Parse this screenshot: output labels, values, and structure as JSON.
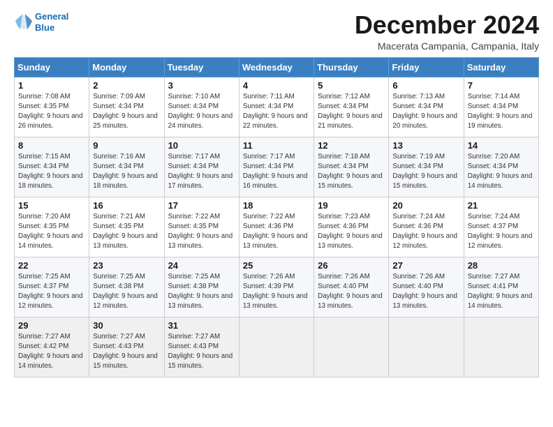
{
  "logo": {
    "line1": "General",
    "line2": "Blue"
  },
  "title": "December 2024",
  "location": "Macerata Campania, Campania, Italy",
  "days_of_week": [
    "Sunday",
    "Monday",
    "Tuesday",
    "Wednesday",
    "Thursday",
    "Friday",
    "Saturday"
  ],
  "weeks": [
    [
      {
        "day": 1,
        "rise": "7:08 AM",
        "set": "4:35 PM",
        "daylight": "9 hours and 26 minutes."
      },
      {
        "day": 2,
        "rise": "7:09 AM",
        "set": "4:34 PM",
        "daylight": "9 hours and 25 minutes."
      },
      {
        "day": 3,
        "rise": "7:10 AM",
        "set": "4:34 PM",
        "daylight": "9 hours and 24 minutes."
      },
      {
        "day": 4,
        "rise": "7:11 AM",
        "set": "4:34 PM",
        "daylight": "9 hours and 22 minutes."
      },
      {
        "day": 5,
        "rise": "7:12 AM",
        "set": "4:34 PM",
        "daylight": "9 hours and 21 minutes."
      },
      {
        "day": 6,
        "rise": "7:13 AM",
        "set": "4:34 PM",
        "daylight": "9 hours and 20 minutes."
      },
      {
        "day": 7,
        "rise": "7:14 AM",
        "set": "4:34 PM",
        "daylight": "9 hours and 19 minutes."
      }
    ],
    [
      {
        "day": 8,
        "rise": "7:15 AM",
        "set": "4:34 PM",
        "daylight": "9 hours and 18 minutes."
      },
      {
        "day": 9,
        "rise": "7:16 AM",
        "set": "4:34 PM",
        "daylight": "9 hours and 18 minutes."
      },
      {
        "day": 10,
        "rise": "7:17 AM",
        "set": "4:34 PM",
        "daylight": "9 hours and 17 minutes."
      },
      {
        "day": 11,
        "rise": "7:17 AM",
        "set": "4:34 PM",
        "daylight": "9 hours and 16 minutes."
      },
      {
        "day": 12,
        "rise": "7:18 AM",
        "set": "4:34 PM",
        "daylight": "9 hours and 15 minutes."
      },
      {
        "day": 13,
        "rise": "7:19 AM",
        "set": "4:34 PM",
        "daylight": "9 hours and 15 minutes."
      },
      {
        "day": 14,
        "rise": "7:20 AM",
        "set": "4:34 PM",
        "daylight": "9 hours and 14 minutes."
      }
    ],
    [
      {
        "day": 15,
        "rise": "7:20 AM",
        "set": "4:35 PM",
        "daylight": "9 hours and 14 minutes."
      },
      {
        "day": 16,
        "rise": "7:21 AM",
        "set": "4:35 PM",
        "daylight": "9 hours and 13 minutes."
      },
      {
        "day": 17,
        "rise": "7:22 AM",
        "set": "4:35 PM",
        "daylight": "9 hours and 13 minutes."
      },
      {
        "day": 18,
        "rise": "7:22 AM",
        "set": "4:36 PM",
        "daylight": "9 hours and 13 minutes."
      },
      {
        "day": 19,
        "rise": "7:23 AM",
        "set": "4:36 PM",
        "daylight": "9 hours and 13 minutes."
      },
      {
        "day": 20,
        "rise": "7:24 AM",
        "set": "4:36 PM",
        "daylight": "9 hours and 12 minutes."
      },
      {
        "day": 21,
        "rise": "7:24 AM",
        "set": "4:37 PM",
        "daylight": "9 hours and 12 minutes."
      }
    ],
    [
      {
        "day": 22,
        "rise": "7:25 AM",
        "set": "4:37 PM",
        "daylight": "9 hours and 12 minutes."
      },
      {
        "day": 23,
        "rise": "7:25 AM",
        "set": "4:38 PM",
        "daylight": "9 hours and 12 minutes."
      },
      {
        "day": 24,
        "rise": "7:25 AM",
        "set": "4:38 PM",
        "daylight": "9 hours and 13 minutes."
      },
      {
        "day": 25,
        "rise": "7:26 AM",
        "set": "4:39 PM",
        "daylight": "9 hours and 13 minutes."
      },
      {
        "day": 26,
        "rise": "7:26 AM",
        "set": "4:40 PM",
        "daylight": "9 hours and 13 minutes."
      },
      {
        "day": 27,
        "rise": "7:26 AM",
        "set": "4:40 PM",
        "daylight": "9 hours and 13 minutes."
      },
      {
        "day": 28,
        "rise": "7:27 AM",
        "set": "4:41 PM",
        "daylight": "9 hours and 14 minutes."
      }
    ],
    [
      {
        "day": 29,
        "rise": "7:27 AM",
        "set": "4:42 PM",
        "daylight": "9 hours and 14 minutes."
      },
      {
        "day": 30,
        "rise": "7:27 AM",
        "set": "4:43 PM",
        "daylight": "9 hours and 15 minutes."
      },
      {
        "day": 31,
        "rise": "7:27 AM",
        "set": "4:43 PM",
        "daylight": "9 hours and 15 minutes."
      },
      null,
      null,
      null,
      null
    ]
  ]
}
